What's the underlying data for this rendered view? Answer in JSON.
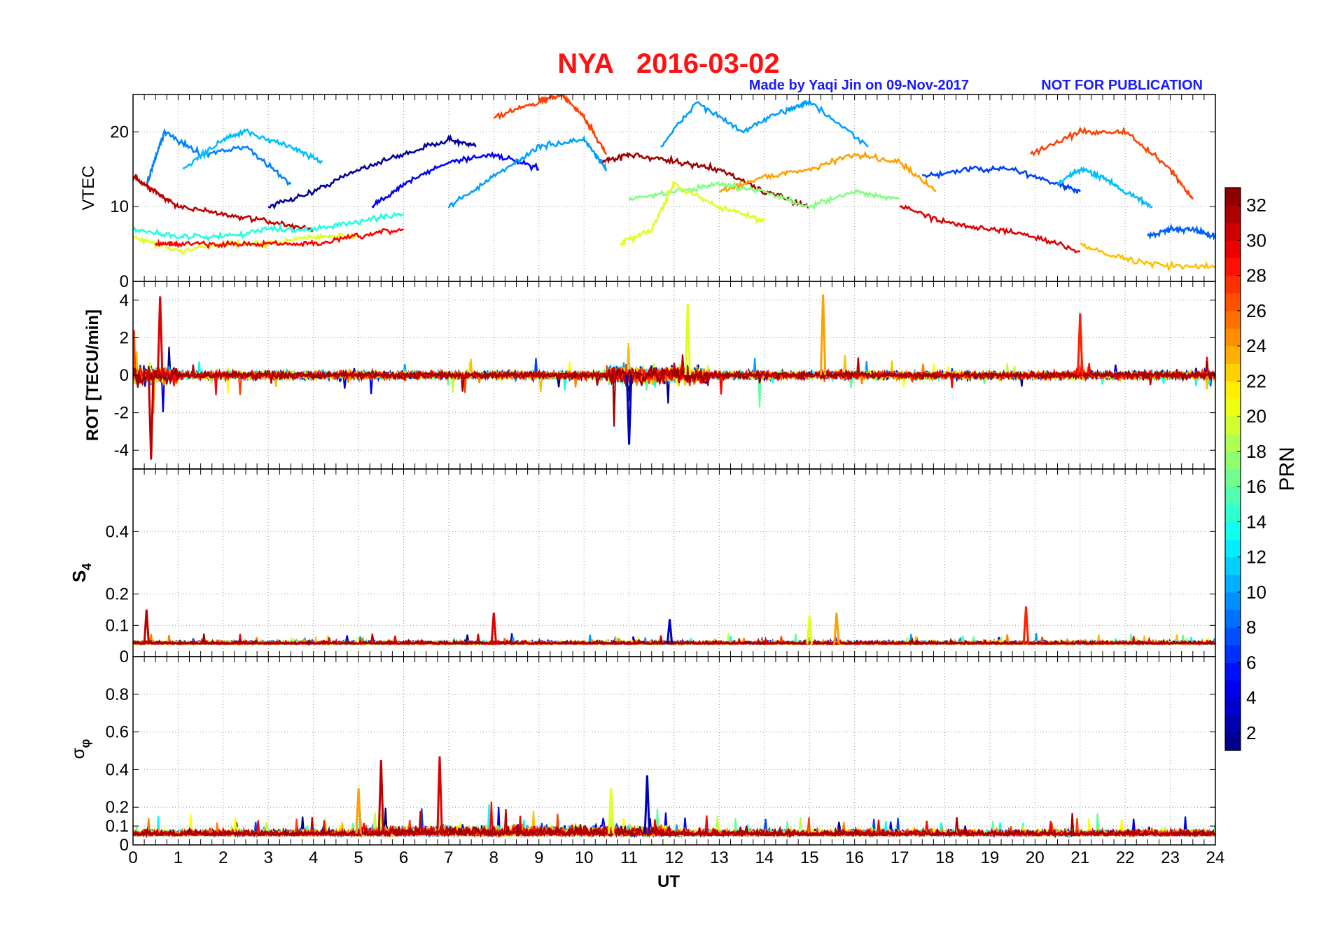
{
  "header": {
    "title": "NYA   2016-03-02",
    "made_by": "Made by Yaqi Jin on 09-Nov-2017",
    "notice": "NOT FOR PUBLICATION",
    "title_color": "#ff1111",
    "subtitle_color": "#1a1aff"
  },
  "chart_data": [
    {
      "type": "line",
      "panel": "vtec",
      "ylabel": "VTEC",
      "xlim": [
        0,
        24
      ],
      "ylim": [
        0,
        25
      ],
      "yticks": [
        0,
        10,
        20
      ],
      "grid": true,
      "series": [
        {
          "prn": 2,
          "x": [
            3.0,
            4.0,
            5.0,
            6.0,
            7.0,
            7.6
          ],
          "y": [
            10,
            12,
            15,
            17,
            19,
            18
          ]
        },
        {
          "prn": 5,
          "x": [
            5.3,
            6.0,
            7.0,
            8.0,
            9.0
          ],
          "y": [
            10,
            13,
            16,
            17,
            15
          ]
        },
        {
          "prn": 9,
          "x": [
            0.3,
            0.7,
            1.5,
            2.5,
            3.5
          ],
          "y": [
            13,
            20,
            17,
            18,
            13
          ]
        },
        {
          "prn": 11,
          "x": [
            1.1,
            2.0,
            2.5,
            3.5,
            4.2
          ],
          "y": [
            15,
            19,
            20,
            18,
            16
          ]
        },
        {
          "prn": 10,
          "x": [
            7.0,
            8.0,
            9.0,
            10.0,
            10.5
          ],
          "y": [
            10,
            14,
            18,
            19,
            15
          ]
        },
        {
          "prn": 10,
          "x": [
            11.7,
            12.5,
            13.5,
            14.5,
            15.0,
            16.3
          ],
          "y": [
            18,
            24,
            20,
            23,
            24,
            18
          ]
        },
        {
          "prn": 7,
          "x": [
            17.5,
            18.5,
            19.5,
            20.5,
            21.0
          ],
          "y": [
            14,
            15,
            15,
            13,
            12
          ]
        },
        {
          "prn": 11,
          "x": [
            20.5,
            21.0,
            21.5,
            22.0,
            22.6
          ],
          "y": [
            13,
            15,
            14,
            12,
            10
          ]
        },
        {
          "prn": 27,
          "x": [
            8.0,
            9.0,
            9.5,
            10.0,
            10.5
          ],
          "y": [
            22,
            24,
            25,
            22,
            17
          ]
        },
        {
          "prn": 27,
          "x": [
            19.9,
            21.0,
            22.0,
            23.0,
            23.5
          ],
          "y": [
            17,
            20,
            20,
            15,
            11
          ]
        },
        {
          "prn": 32,
          "x": [
            10.4,
            11.0,
            12.0,
            13.0,
            14.0,
            15.0
          ],
          "y": [
            16,
            17,
            16,
            15,
            12,
            10
          ]
        },
        {
          "prn": 24,
          "x": [
            13.0,
            14.0,
            15.0,
            16.0,
            17.0,
            17.8
          ],
          "y": [
            12,
            14,
            15,
            17,
            16,
            12
          ]
        },
        {
          "prn": 31,
          "x": [
            0.0,
            0.5,
            1.0,
            2.0,
            3.0,
            4.0
          ],
          "y": [
            14,
            12,
            10,
            9,
            8,
            7
          ]
        },
        {
          "prn": 30,
          "x": [
            17.0,
            18.0,
            19.0,
            20.0,
            21.0
          ],
          "y": [
            10,
            8,
            7,
            6,
            4
          ]
        },
        {
          "prn": 20,
          "x": [
            0.0,
            1.0,
            2.0,
            3.0,
            4.0,
            5.0
          ],
          "y": [
            6,
            4,
            5,
            5,
            6,
            6
          ]
        },
        {
          "prn": 14,
          "x": [
            0.0,
            1.0,
            2.0,
            3.0,
            4.0,
            5.0,
            6.0
          ],
          "y": [
            7,
            6,
            6,
            7,
            7,
            8,
            9
          ]
        },
        {
          "prn": 29,
          "x": [
            0.5,
            1.0,
            2.0,
            3.0,
            4.0,
            5.0,
            6.0
          ],
          "y": [
            5,
            5,
            5,
            5,
            5,
            6,
            7
          ]
        },
        {
          "prn": 17,
          "x": [
            11.0,
            12.0,
            13.0,
            14.0,
            15.0,
            16.0,
            17.0
          ],
          "y": [
            11,
            12,
            13,
            12,
            10,
            12,
            11
          ]
        },
        {
          "prn": 20,
          "x": [
            10.8,
            11.5,
            12.0,
            13.0,
            14.0
          ],
          "y": [
            5,
            7,
            13,
            10,
            8
          ]
        },
        {
          "prn": 23,
          "x": [
            21.0,
            22.0,
            23.0,
            24.0
          ],
          "y": [
            5,
            3,
            2,
            2
          ]
        },
        {
          "prn": 8,
          "x": [
            22.5,
            23.0,
            23.5,
            24.0
          ],
          "y": [
            6,
            7,
            7,
            6
          ]
        }
      ]
    },
    {
      "type": "line",
      "panel": "rot",
      "ylabel": "ROT [TECU/min]",
      "xlim": [
        0,
        24
      ],
      "ylim": [
        -5,
        5
      ],
      "yticks": [
        -4,
        -2,
        0,
        2,
        4
      ],
      "grid": true,
      "summary": "All PRNs fluctuate around 0 TECU/min with peaks of about +4.2 (near 0.6 UT and 15.3 UT) and troughs near -4.5 (near 0.4 UT); larger spread between 10.5 and 12.5 UT.",
      "peaks": [
        {
          "x": 0.4,
          "y": -4.5
        },
        {
          "x": 0.6,
          "y": 4.2
        },
        {
          "x": 11.0,
          "y": -3.7
        },
        {
          "x": 12.3,
          "y": 3.8
        },
        {
          "x": 15.3,
          "y": 4.3
        },
        {
          "x": 21.0,
          "y": 3.3
        }
      ]
    },
    {
      "type": "line",
      "panel": "s4",
      "ylabel": "S4",
      "xlim": [
        0,
        24
      ],
      "ylim": [
        0,
        0.6
      ],
      "yticks": [
        0,
        0.1,
        0.2,
        0.4
      ],
      "grid": true,
      "summary": "S4 baseline around 0.03-0.06 with isolated enhancements up to about 0.15.",
      "peaks": [
        {
          "x": 0.3,
          "y": 0.15
        },
        {
          "x": 8.0,
          "y": 0.14
        },
        {
          "x": 11.9,
          "y": 0.12
        },
        {
          "x": 15.0,
          "y": 0.13
        },
        {
          "x": 15.6,
          "y": 0.14
        },
        {
          "x": 19.8,
          "y": 0.16
        }
      ]
    },
    {
      "type": "line",
      "panel": "sigma_phi",
      "ylabel": "σφ",
      "xlabel": "UT",
      "xlim": [
        0,
        24
      ],
      "ylim": [
        0,
        1.0
      ],
      "yticks": [
        0,
        0.1,
        0.2,
        0.4,
        0.6,
        0.8
      ],
      "xticks": [
        0,
        1,
        2,
        3,
        4,
        5,
        6,
        7,
        8,
        9,
        10,
        11,
        12,
        13,
        14,
        15,
        16,
        17,
        18,
        19,
        20,
        21,
        22,
        23,
        24
      ],
      "grid": true,
      "summary": "Phase scintillation baseline around 0.05-0.1, with enhanced activity 5-12 UT and spikes up to about 0.47.",
      "peaks": [
        {
          "x": 5.5,
          "y": 0.45
        },
        {
          "x": 6.8,
          "y": 0.47
        },
        {
          "x": 11.4,
          "y": 0.37
        },
        {
          "x": 10.6,
          "y": 0.3
        },
        {
          "x": 5.0,
          "y": 0.3
        }
      ]
    }
  ],
  "colorbar": {
    "label": "PRN",
    "min": 1,
    "max": 33,
    "ticks": [
      2,
      4,
      6,
      8,
      10,
      12,
      14,
      16,
      18,
      20,
      22,
      24,
      26,
      28,
      30,
      32
    ]
  }
}
